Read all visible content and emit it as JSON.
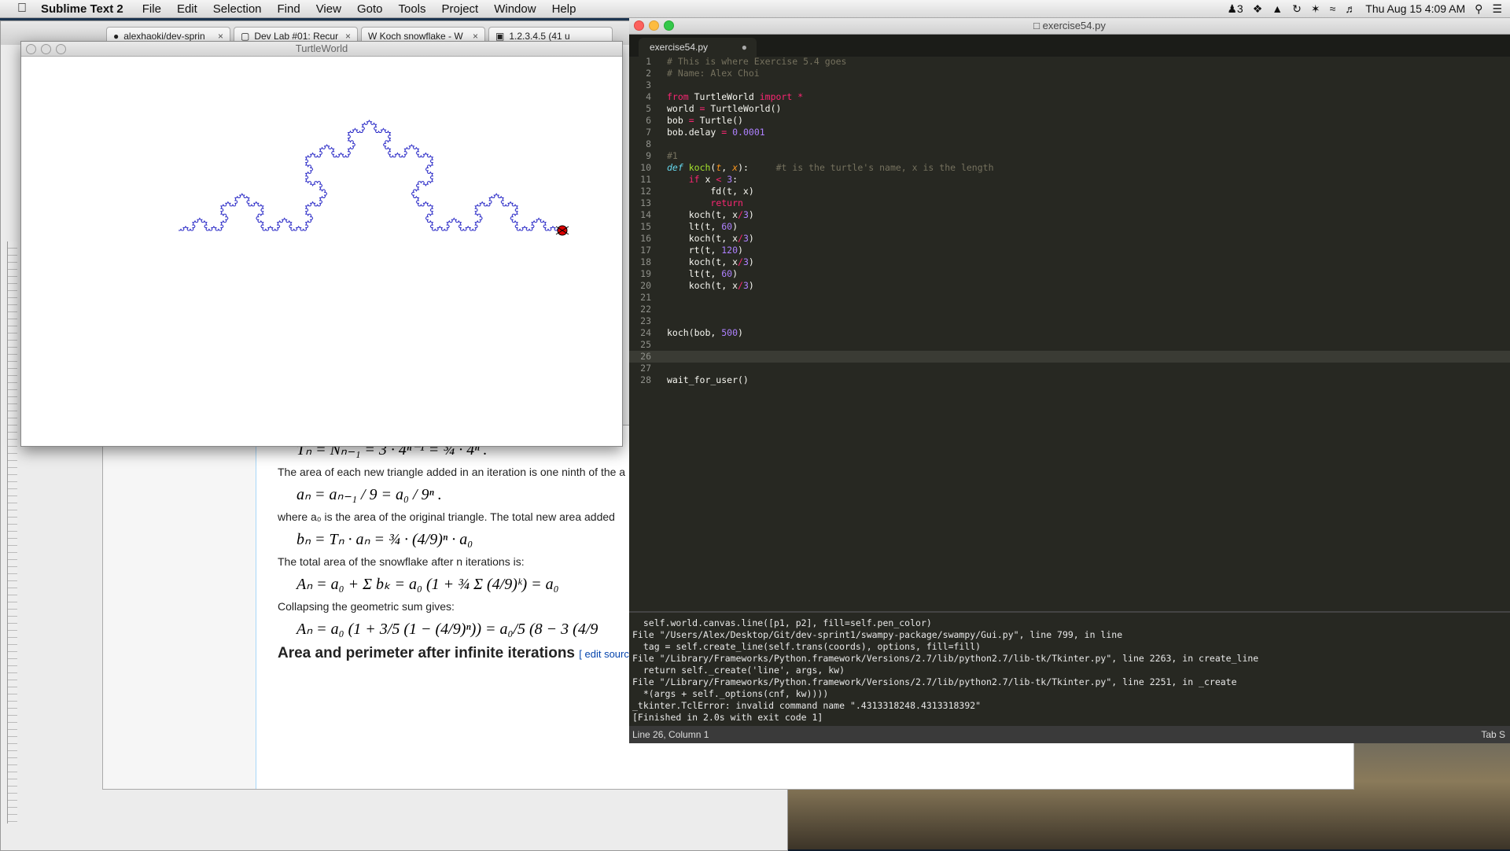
{
  "menubar": {
    "app_name": "Sublime Text 2",
    "items": [
      "File",
      "Edit",
      "Selection",
      "Find",
      "View",
      "Goto",
      "Tools",
      "Project",
      "Window",
      "Help"
    ],
    "status": {
      "badge": "3",
      "clock": "Thu Aug 15  4:09 AM"
    }
  },
  "browser": {
    "tabs": [
      "alexhaoki/dev-sprin",
      "Dev Lab #01: Recur",
      "W Koch snowflake - W",
      "1.2.3.4.5 (41 u"
    ]
  },
  "wiki": {
    "formula_T": "Tₙ = Nₙ₋₁ = 3 · 4ⁿ⁻¹ = ¾ · 4ⁿ .",
    "text_area": "The area of each new triangle added in an iteration is one ninth of the a",
    "formula_a": "aₙ = aₙ₋₁ / 9 = a₀ / 9ⁿ .",
    "text_where": "where a₀ is the area of the original triangle. The total new area added",
    "formula_b": "bₙ = Tₙ · aₙ = ¾ · (4/9)ⁿ · a₀",
    "text_total": "The total area of the snowflake after n iterations is:",
    "formula_A": "Aₙ = a₀ + Σ bₖ = a₀ (1 + ¾ Σ (4/9)ᵏ) = a₀",
    "text_collapse": "Collapsing the geometric sum gives:",
    "formula_A2": "Aₙ = a₀ (1 + 3/5 (1 − (4/9)ⁿ)) = a₀/5 (8 − 3 (4/9",
    "heading": "Area and perimeter after infinite iterations",
    "edit_source": "[ edit source | edit beta ]"
  },
  "turtle_window": {
    "title": "TurtleWorld"
  },
  "sublime": {
    "title": "exercise54.py",
    "tab": "exercise54.py",
    "code_lines": [
      "# This is where Exercise 5.4 goes",
      "# Name: Alex Choi",
      "",
      "from TurtleWorld import *",
      "world = TurtleWorld()",
      "bob = Turtle()",
      "bob.delay = 0.0001",
      "",
      "#1",
      "def koch(t, x):     #t is the turtle's name, x is the length",
      "    if x < 3:",
      "        fd(t, x)",
      "        return",
      "    koch(t, x/3)",
      "    lt(t, 60)",
      "    koch(t, x/3)",
      "    rt(t, 120)",
      "    koch(t, x/3)",
      "    lt(t, 60)",
      "    koch(t, x/3)",
      "",
      "",
      "",
      "koch(bob, 500)",
      "",
      "",
      "",
      "wait_for_user()"
    ],
    "console_lines": [
      "  self.world.canvas.line([p1, p2], fill=self.pen_color)",
      "File \"/Users/Alex/Desktop/Git/dev-sprint1/swampy-package/swampy/Gui.py\", line 799, in line",
      "  tag = self.create_line(self.trans(coords), options, fill=fill)",
      "File \"/Library/Frameworks/Python.framework/Versions/2.7/lib/python2.7/lib-tk/Tkinter.py\", line 2263, in create_line",
      "  return self._create('line', args, kw)",
      "File \"/Library/Frameworks/Python.framework/Versions/2.7/lib/python2.7/lib-tk/Tkinter.py\", line 2251, in _create",
      "  *(args + self._options(cnf, kw))))",
      "_tkinter.TclError: invalid command name \".4313318248.4313318392\"",
      "[Finished in 2.0s with exit code 1]"
    ],
    "status_left": "Line 26, Column 1",
    "status_right": "Tab S"
  }
}
